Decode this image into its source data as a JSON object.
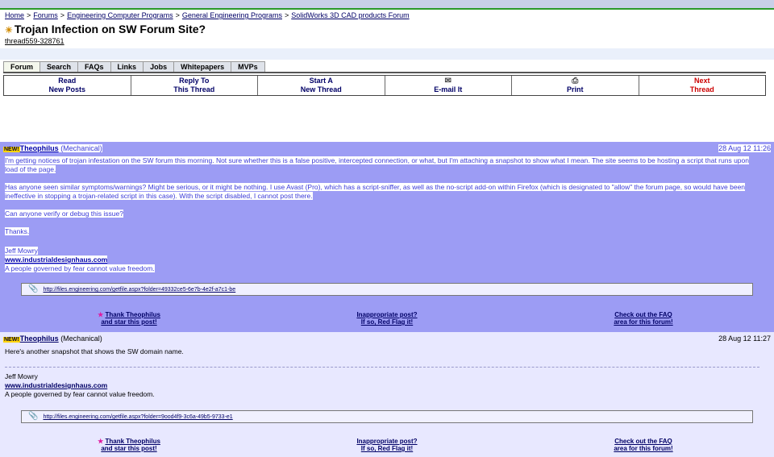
{
  "breadcrumb": {
    "items": [
      "Home",
      "Forums",
      "Engineering Computer Programs",
      "General Engineering Programs",
      "SolidWorks 3D CAD products Forum"
    ],
    "separator": ">"
  },
  "thread": {
    "title": "Trojan Infection on SW Forum Site?",
    "id": "thread559-328761"
  },
  "tabs": [
    "Forum",
    "Search",
    "FAQs",
    "Links",
    "Jobs",
    "Whitepapers",
    "MVPs"
  ],
  "actions": {
    "read": [
      "Read",
      "New Posts"
    ],
    "reply": [
      "Reply To",
      "This Thread"
    ],
    "start": [
      "Start A",
      "New Thread"
    ],
    "email": "E-mail It",
    "print": "Print",
    "next": [
      "Next",
      "Thread"
    ]
  },
  "posts": [
    {
      "badge": "NEW!",
      "user": "Theophilus",
      "role": "(Mechanical)",
      "date": "28 Aug 12 11:26",
      "paragraphs": [
        "I'm getting notices of trojan infestation on the SW forum this morning. Not sure whether this is a false positive, intercepted connection, or what, but I'm attaching a snapshot to show what I mean. The site seems to be hosting a script that runs upon load of the page.",
        "Has anyone seen similar symptoms/warnings? Might be serious, or it might be nothing. I use Avast (Pro), which has a script-sniffer, as well as the no-script add-on within Firefox (which is designated to \"allow\" the forum page, so would have been ineffective in stopping a trojan-related script in this case). With the script disabled, I cannot post there.",
        "Can anyone verify or debug this issue?",
        "Thanks."
      ],
      "sig_name": "Jeff Mowry",
      "sig_url": "www.industrialdesignhaus.com",
      "sig_quote": "A people governed by fear cannot value freedom.",
      "attachment": "http://files.engineering.com/getfile.aspx?folder=49332ce5-6e7b-4e2f-a7c1-be",
      "footer": {
        "thank": [
          "Thank Theophilus",
          "and star this post!"
        ],
        "flag": [
          "Inappropriate post?",
          "If so, Red Flag it!"
        ],
        "faq": [
          "Check out the FAQ",
          "area for this forum!"
        ]
      }
    },
    {
      "badge": "NEW!",
      "user": "Theophilus",
      "role": "(Mechanical)",
      "date": "28 Aug 12 11:27",
      "paragraphs": [
        "Here's another snapshot that shows the SW domain name."
      ],
      "sig_name": "Jeff Mowry",
      "sig_url": "www.industrialdesignhaus.com",
      "sig_quote": "A people governed by fear cannot value freedom.",
      "attachment": "http://files.engineering.com/getfile.aspx?folder=9ood4f9-3c6a-49b5-9733-e1",
      "footer": {
        "thank": [
          "Thank Theophilus",
          "and star this post!"
        ],
        "flag": [
          "Inappropriate post?",
          "If so, Red Flag it!"
        ],
        "faq": [
          "Check out the FAQ",
          "area for this forum!"
        ]
      }
    }
  ]
}
